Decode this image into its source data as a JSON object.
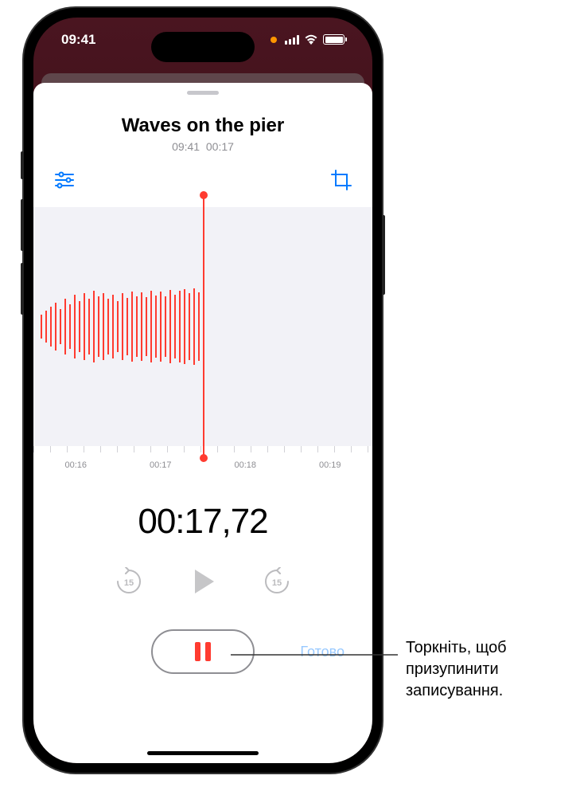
{
  "status_bar": {
    "time": "09:41"
  },
  "recording": {
    "title": "Waves on the pier",
    "clock_time": "09:41",
    "duration": "00:17"
  },
  "ruler": {
    "t1": "00:16",
    "t2": "00:17",
    "t3": "00:18",
    "t4": "00:19"
  },
  "timer": "00:17,72",
  "skip_back_label": "15",
  "skip_forward_label": "15",
  "done_label": "Готово",
  "callout": "Торкніть, щоб призупинити записування.",
  "colors": {
    "accent_blue": "#007aff",
    "accent_red": "#ff3b30",
    "gray": "#8e8e93"
  }
}
